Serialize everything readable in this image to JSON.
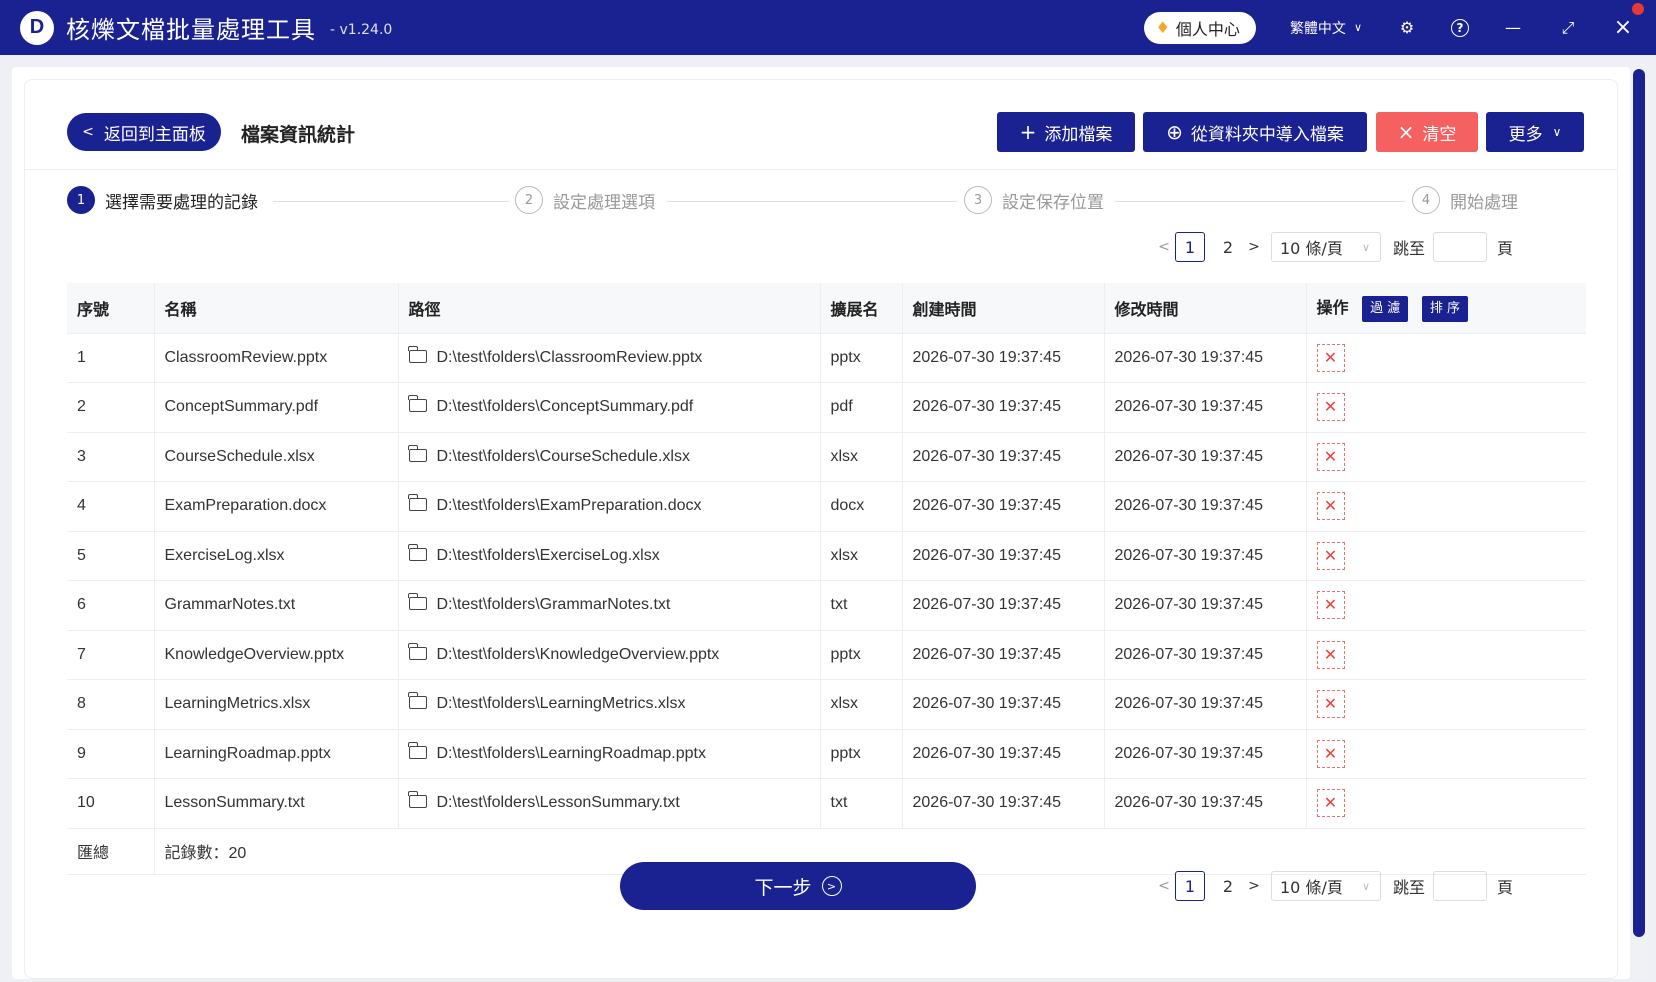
{
  "app": {
    "logo_letter": "D",
    "title": "核爍文檔批量處理工具",
    "version": "- v1.24.0",
    "user_center": "個人中心",
    "language": "繁體中文"
  },
  "toolbar": {
    "back_label": "返回到主面板",
    "page_title": "檔案資訊統計",
    "add_label": "添加檔案",
    "import_label": "從資料夾中導入檔案",
    "clear_label": "清空",
    "more_label": "更多"
  },
  "steps": [
    {
      "num": "1",
      "label": "選擇需要處理的記錄",
      "active": true
    },
    {
      "num": "2",
      "label": "設定處理選項",
      "active": false
    },
    {
      "num": "3",
      "label": "設定保存位置",
      "active": false
    },
    {
      "num": "4",
      "label": "開始處理",
      "active": false
    }
  ],
  "pagination": {
    "pages": [
      "1",
      "2"
    ],
    "current": "1",
    "page_size": "10 條/頁",
    "jump_label": "跳至",
    "page_label": "頁"
  },
  "table": {
    "headers": {
      "index": "序號",
      "name": "名稱",
      "path": "路徑",
      "ext": "擴展名",
      "created": "創建時間",
      "modified": "修改時間",
      "actions": "操作"
    },
    "filter_label": "過 濾",
    "sort_label": "排 序",
    "rows": [
      {
        "index": "1",
        "name": "ClassroomReview.pptx",
        "path": "D:\\test\\folders\\ClassroomReview.pptx",
        "ext": "pptx",
        "created": "2026-07-30 19:37:45",
        "modified": "2026-07-30 19:37:45"
      },
      {
        "index": "2",
        "name": "ConceptSummary.pdf",
        "path": "D:\\test\\folders\\ConceptSummary.pdf",
        "ext": "pdf",
        "created": "2026-07-30 19:37:45",
        "modified": "2026-07-30 19:37:45"
      },
      {
        "index": "3",
        "name": "CourseSchedule.xlsx",
        "path": "D:\\test\\folders\\CourseSchedule.xlsx",
        "ext": "xlsx",
        "created": "2026-07-30 19:37:45",
        "modified": "2026-07-30 19:37:45"
      },
      {
        "index": "4",
        "name": "ExamPreparation.docx",
        "path": "D:\\test\\folders\\ExamPreparation.docx",
        "ext": "docx",
        "created": "2026-07-30 19:37:45",
        "modified": "2026-07-30 19:37:45"
      },
      {
        "index": "5",
        "name": "ExerciseLog.xlsx",
        "path": "D:\\test\\folders\\ExerciseLog.xlsx",
        "ext": "xlsx",
        "created": "2026-07-30 19:37:45",
        "modified": "2026-07-30 19:37:45"
      },
      {
        "index": "6",
        "name": "GrammarNotes.txt",
        "path": "D:\\test\\folders\\GrammarNotes.txt",
        "ext": "txt",
        "created": "2026-07-30 19:37:45",
        "modified": "2026-07-30 19:37:45"
      },
      {
        "index": "7",
        "name": "KnowledgeOverview.pptx",
        "path": "D:\\test\\folders\\KnowledgeOverview.pptx",
        "ext": "pptx",
        "created": "2026-07-30 19:37:45",
        "modified": "2026-07-30 19:37:45"
      },
      {
        "index": "8",
        "name": "LearningMetrics.xlsx",
        "path": "D:\\test\\folders\\LearningMetrics.xlsx",
        "ext": "xlsx",
        "created": "2026-07-30 19:37:45",
        "modified": "2026-07-30 19:37:45"
      },
      {
        "index": "9",
        "name": "LearningRoadmap.pptx",
        "path": "D:\\test\\folders\\LearningRoadmap.pptx",
        "ext": "pptx",
        "created": "2026-07-30 19:37:45",
        "modified": "2026-07-30 19:37:45"
      },
      {
        "index": "10",
        "name": "LessonSummary.txt",
        "path": "D:\\test\\folders\\LessonSummary.txt",
        "ext": "txt",
        "created": "2026-07-30 19:37:45",
        "modified": "2026-07-30 19:37:45"
      }
    ],
    "summary_label": "匯總",
    "summary_value": "記錄數：20"
  },
  "footer": {
    "next_label": "下一步"
  },
  "colors": {
    "primary": "#1a2190",
    "danger": "#f56161",
    "accent": "#f5a623"
  }
}
